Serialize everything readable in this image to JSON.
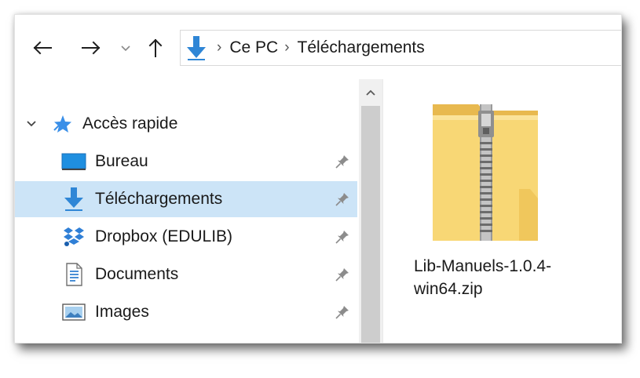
{
  "window": {
    "breadcrumbs": [
      {
        "label": "Ce PC"
      },
      {
        "label": "Téléchargements"
      }
    ],
    "breadcrumb_separator": "›"
  },
  "icons": {
    "back": "arrow-left-icon",
    "forward": "arrow-right-icon",
    "recent": "chevron-down-icon",
    "up": "arrow-up-icon",
    "location": "download-arrow-icon",
    "pin": "pin-icon"
  },
  "colors": {
    "selection": "#cce4f7",
    "download_blue": "#2f86d6",
    "folder_yellow": "#f8d775",
    "quick_access_star": "#3a8fe8"
  },
  "navpane": {
    "quick_access": {
      "label": "Accès rapide",
      "expanded": true
    },
    "items": [
      {
        "label": "Bureau",
        "icon": "desktop-icon",
        "pinned": true,
        "selected": false
      },
      {
        "label": "Téléchargements",
        "icon": "downloads-icon",
        "pinned": true,
        "selected": true
      },
      {
        "label": "Dropbox (EDULIB)",
        "icon": "dropbox-icon",
        "pinned": true,
        "selected": false
      },
      {
        "label": "Documents",
        "icon": "documents-icon",
        "pinned": true,
        "selected": false
      },
      {
        "label": "Images",
        "icon": "images-icon",
        "pinned": true,
        "selected": false
      }
    ]
  },
  "content": {
    "files": [
      {
        "name": "Lib-Manuels-1.0.4-win64.zip",
        "icon": "zip-folder-icon"
      }
    ]
  }
}
